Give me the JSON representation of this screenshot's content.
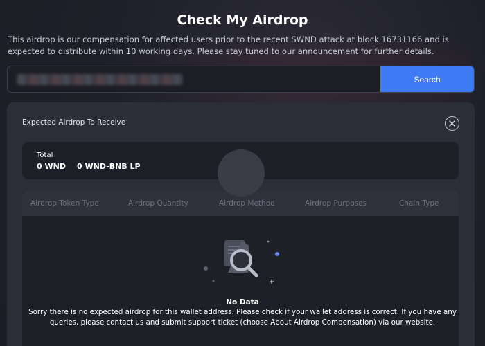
{
  "page": {
    "title": "Check My Airdrop",
    "intro": "This airdrop is our compensation for affected users prior to the recent SWND attack at block 16731166 and is expected to distribute within 10 working days. Please stay tuned to our announcement for further details."
  },
  "search": {
    "value": "",
    "button_label": "Search"
  },
  "panel": {
    "title": "Expected Airdrop To Receive",
    "close_icon": "close-icon"
  },
  "total": {
    "label": "Total",
    "wnd": "0 WND",
    "lp": "0 WND-BNB LP"
  },
  "table": {
    "columns": [
      "Airdrop Token Type",
      "Airdrop Quantity",
      "Airdrop Method",
      "Airdrop Purposes",
      "Chain Type"
    ]
  },
  "empty_state": {
    "icon": "empty-search-icon",
    "title": "No Data",
    "description": "Sorry there is no expected airdrop for this wallet address. Please check if your wallet address is correct. If you have any queries, please contact us and submit support ticket (choose About Airdrop Compensation) via our website."
  },
  "colors": {
    "accent": "#3f7bf5",
    "panel": "#2b2e37",
    "card": "#1e2028"
  }
}
